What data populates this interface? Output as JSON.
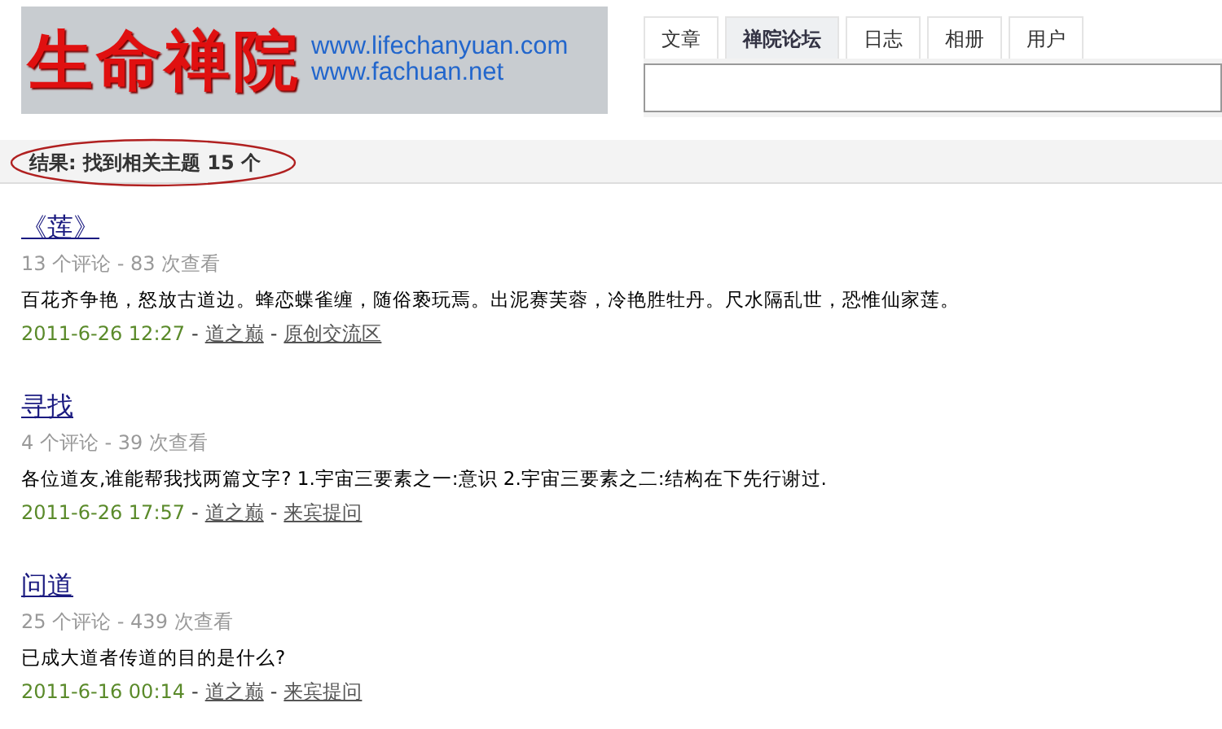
{
  "logo": {
    "name": "生命禅院",
    "urls": [
      "www.lifechanyuan.com",
      "www.fachuan.net"
    ]
  },
  "tabs": [
    {
      "label": "文章",
      "selected": false
    },
    {
      "label": "禅院论坛",
      "selected": true
    },
    {
      "label": "日志",
      "selected": false
    },
    {
      "label": "相册",
      "selected": false
    },
    {
      "label": "用户",
      "selected": false
    }
  ],
  "results": {
    "label": "结果: 找到相关主题",
    "count": "15 个",
    "highlighted": true
  },
  "posts": [
    {
      "title": "《莲》",
      "meta": "13 个评论 - 83 次查看",
      "excerpt": "百花齐争艳，怒放古道边。蜂恋蝶雀缠，随俗亵玩焉。出泥赛芙蓉，冷艳胜牡丹。尺水隔乱世，恐惟仙家莲。",
      "date": "2011-6-26 12:27",
      "author": "道之巅",
      "forum": "原创交流区",
      "separator": "-"
    },
    {
      "title": "寻找",
      "meta": "4 个评论 - 39 次查看",
      "excerpt": "各位道友,谁能帮我找两篇文字? 1.宇宙三要素之一:意识 2.宇宙三要素之二:结构在下先行谢过.",
      "date": "2011-6-26 17:57",
      "author": "道之巅",
      "forum": "来宾提问",
      "separator": "-"
    },
    {
      "title": "问道",
      "meta": "25 个评论 - 439 次查看",
      "excerpt": "已成大道者传道的目的是什么?",
      "date": "2011-6-16 00:14",
      "author": "道之巅",
      "forum": "来宾提问",
      "separator": "-"
    }
  ]
}
